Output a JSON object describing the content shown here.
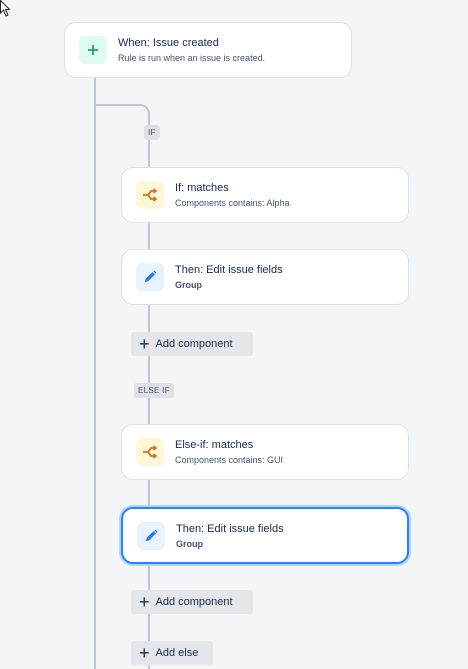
{
  "trigger": {
    "title": "When: Issue created",
    "subtitle": "Rule is run when an issue is created.",
    "icon": "plus-icon"
  },
  "branches": [
    {
      "tag": "IF",
      "condition": {
        "title": "If: matches",
        "subtitle": "Components contains: Alpha",
        "icon": "branch-icon"
      },
      "action": {
        "title": "Then: Edit issue fields",
        "subtitle": "Group",
        "icon": "pencil-icon"
      },
      "add_label": "Add component"
    },
    {
      "tag": "ELSE IF",
      "condition": {
        "title": "Else-if: matches",
        "subtitle": "Components contains: GUI",
        "icon": "branch-icon"
      },
      "action": {
        "title": "Then: Edit issue fields",
        "subtitle": "Group",
        "icon": "pencil-icon"
      },
      "add_label": "Add component"
    }
  ],
  "add_else_label": "Add else",
  "colors": {
    "accent": "#2684ff",
    "trigger_icon": "#22a06b",
    "condition_icon": "#e56910",
    "action_icon": "#1d7afc"
  }
}
